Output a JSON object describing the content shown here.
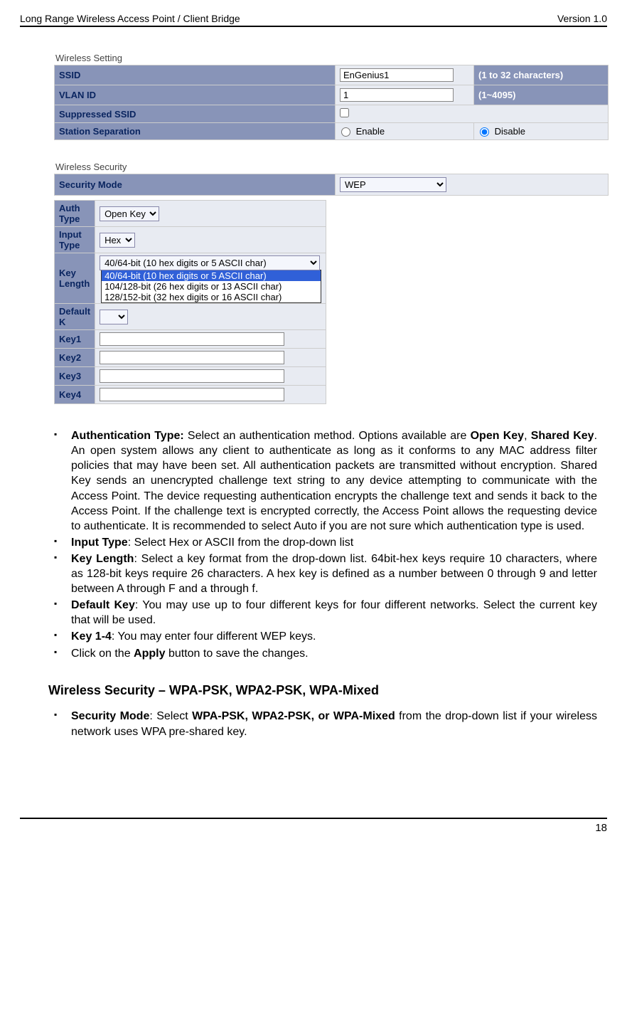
{
  "header": {
    "left": "Long Range Wireless Access Point / Client Bridge",
    "right": "Version 1.0"
  },
  "footer": {
    "page": "18"
  },
  "wireless_setting": {
    "caption": "Wireless Setting",
    "rows": {
      "ssid": {
        "label": "SSID",
        "value": "EnGenius1",
        "hint": "(1 to 32 characters)"
      },
      "vlan": {
        "label": "VLAN ID",
        "value": "1",
        "hint": "(1~4095)"
      },
      "suppressed": {
        "label": "Suppressed SSID"
      },
      "station": {
        "label": "Station Separation",
        "enable": "Enable",
        "disable": "Disable"
      }
    }
  },
  "wireless_security": {
    "caption": "Wireless Security",
    "security_mode": {
      "label": "Security Mode",
      "value": "WEP"
    },
    "auth_type": {
      "label": "Auth Type",
      "value": "Open Key"
    },
    "input_type": {
      "label": "Input Type",
      "value": "Hex"
    },
    "key_length": {
      "label": "Key Length",
      "selected": "40/64-bit (10 hex digits or 5 ASCII char)",
      "options": [
        "40/64-bit (10 hex digits or 5 ASCII char)",
        "104/128-bit (26 hex digits or 13 ASCII char)",
        "128/152-bit (32 hex digits or 16 ASCII char)"
      ]
    },
    "default_key": {
      "label": "Default K"
    },
    "keys": {
      "k1": "Key1",
      "k2": "Key2",
      "k3": "Key3",
      "k4": "Key4"
    }
  },
  "bullets": {
    "auth_head": "Authentication Type:",
    "auth_body": " Select an authentication method. Options available are ",
    "auth_b1": "Open Key",
    "auth_mid": ", ",
    "auth_b2": "Shared Key",
    "auth_rest": ". An open system allows any client to authenticate as long as it conforms to any MAC address filter policies that may have been set. All authentication packets are transmitted without encryption. Shared Key sends an unencrypted challenge text string to any device attempting to communicate with the Access Point. The device requesting authentication encrypts the challenge text and sends it back to the Access Point. If the challenge text is encrypted correctly, the Access Point allows the requesting device to authenticate. It is recommended to select Auto if you are not sure which authentication type is used.",
    "input_head": "Input Type",
    "input_body": ": Select Hex or ASCII from the drop-down list",
    "keylen_head": "Key Length",
    "keylen_body": ": Select a key format from the drop-down list. 64bit-hex keys require 10 characters, where as 128-bit keys require 26 characters. A hex key is defined as a number between 0 through 9 and letter between A through F and a through f.",
    "default_head": "Default Key",
    "default_body": ": You may use up to four different keys for four different networks. Select the current key that will be used.",
    "keys14_head": "Key 1-4",
    "keys14_body": ": You may enter four different WEP keys.",
    "apply_pre": "Click on the ",
    "apply_b": "Apply",
    "apply_post": " button to save the changes."
  },
  "section2": {
    "heading": "Wireless Security – WPA-PSK, WPA2-PSK, WPA-Mixed",
    "sec_head": "Security Mode",
    "sec_mid": ": Select ",
    "sec_b": "WPA-PSK, WPA2-PSK, or WPA-Mixed",
    "sec_post": " from the drop-down list if your wireless network uses WPA pre-shared key."
  }
}
